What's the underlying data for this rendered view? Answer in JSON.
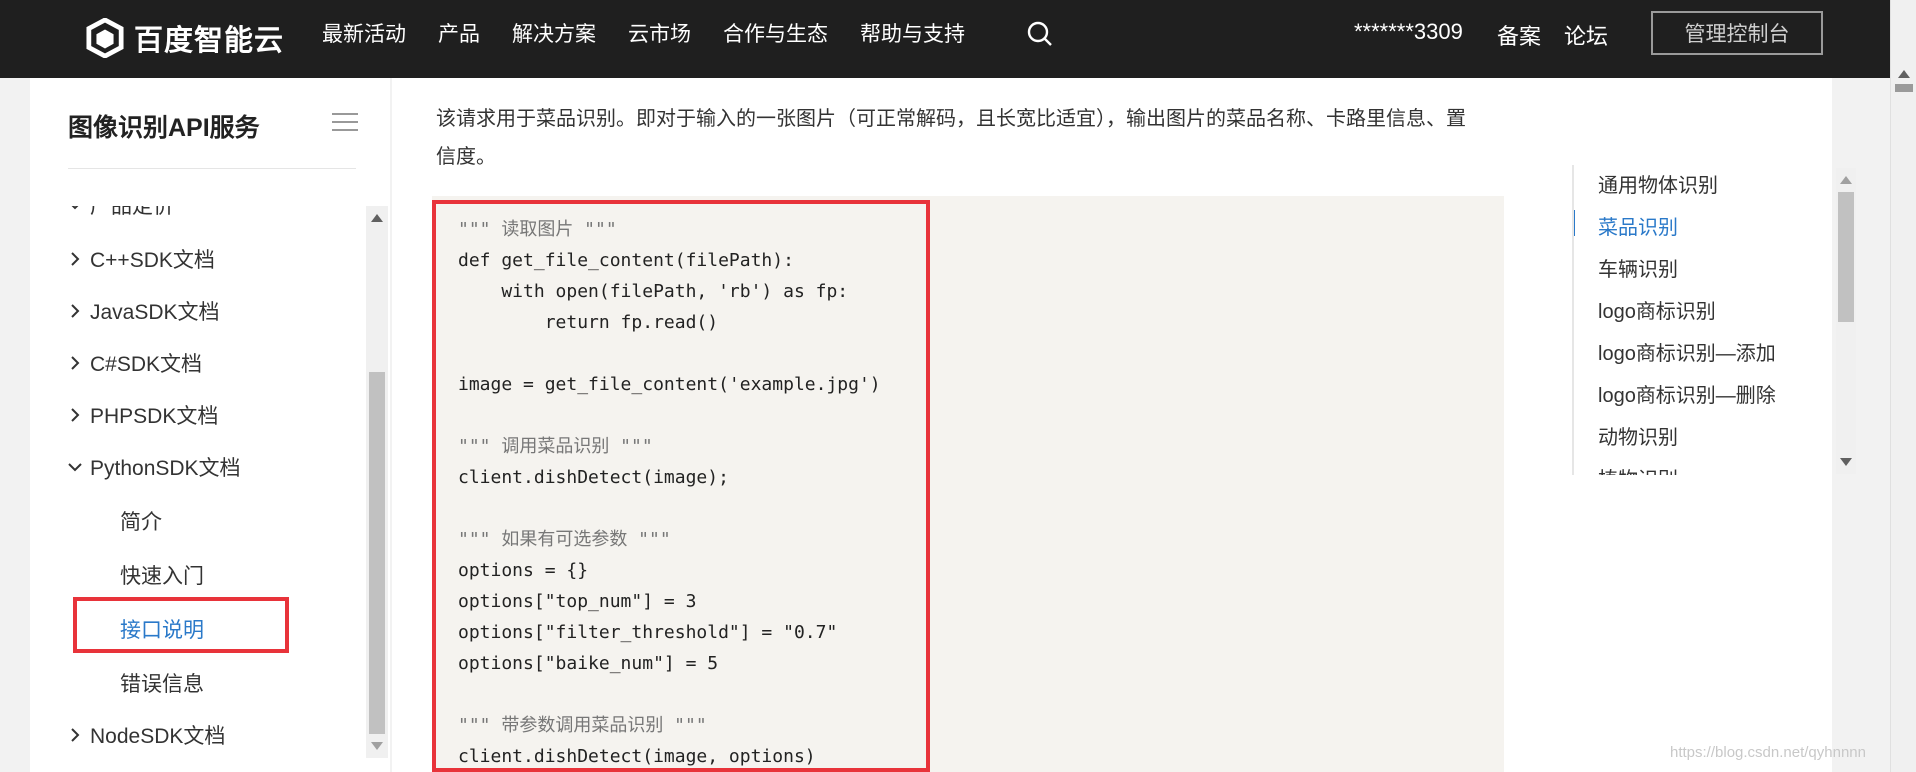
{
  "header": {
    "brand": "百度智能云",
    "nav": [
      "最新活动",
      "产品",
      "解决方案",
      "云市场",
      "合作与生态",
      "帮助与支持"
    ],
    "user": "*******3309",
    "beian": "备案",
    "forum": "论坛",
    "console_button": "管理控制台"
  },
  "sidebar": {
    "title": "图像识别API服务",
    "partial_item": "产品定价",
    "items": [
      {
        "label": "C++SDK文档"
      },
      {
        "label": "JavaSDK文档"
      },
      {
        "label": "C#SDK文档"
      },
      {
        "label": "PHPSDK文档"
      },
      {
        "label": "PythonSDK文档"
      },
      {
        "label": "NodeSDK文档"
      }
    ],
    "sub_items": [
      "简介",
      "快速入门",
      "接口说明",
      "错误信息"
    ]
  },
  "content": {
    "intro": "该请求用于菜品识别。即对于输入的一张图片（可正常解码，且长宽比适宜），输出图片的菜品名称、卡路里信息、置信度。",
    "code": [
      "\"\"\" 读取图片 \"\"\"",
      "def get_file_content(filePath):",
      "    with open(filePath, 'rb') as fp:",
      "        return fp.read()",
      "",
      "image = get_file_content('example.jpg')",
      "",
      "\"\"\" 调用菜品识别 \"\"\"",
      "client.dishDetect(image);",
      "",
      "\"\"\" 如果有可选参数 \"\"\"",
      "options = {}",
      "options[\"top_num\"] = 3",
      "options[\"filter_threshold\"] = \"0.7\"",
      "options[\"baike_num\"] = 5",
      "",
      "\"\"\" 带参数调用菜品识别 \"\"\"",
      "client.dishDetect(image, options)"
    ]
  },
  "toc": {
    "items": [
      "通用物体识别",
      "菜品识别",
      "车辆识别",
      "logo商标识别",
      "logo商标识别—添加",
      "logo商标识别—删除",
      "动物识别",
      "植物识别"
    ],
    "active_index": 1
  },
  "watermark": "https://blog.csdn.net/qyhnnnn",
  "colors": {
    "accent": "#2a79c9",
    "highlight": "#e8333a",
    "nav_bg": "#1f1f1f"
  }
}
